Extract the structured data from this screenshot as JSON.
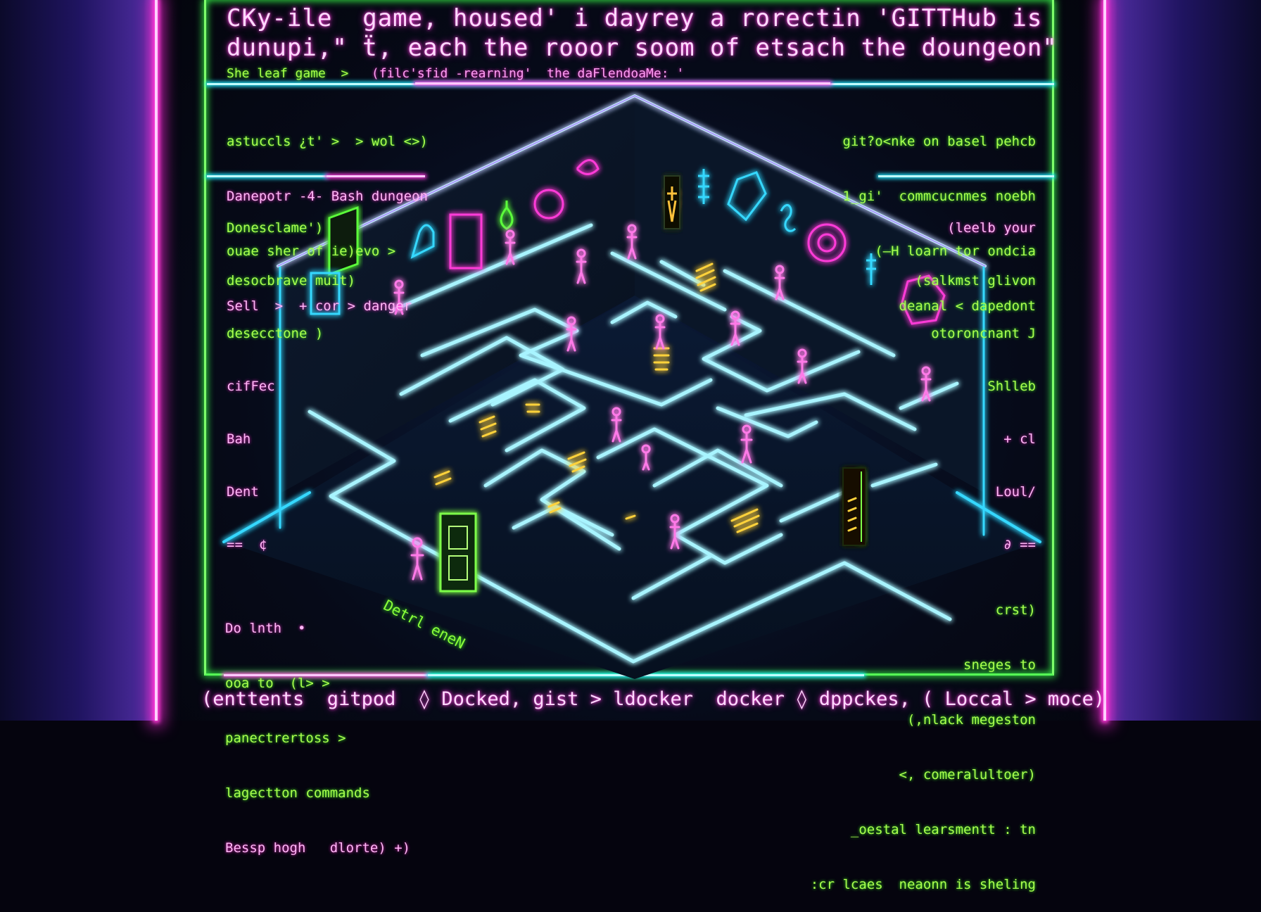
{
  "scene": {
    "title_lines": [
      "CKy-ile  game, housed' i dayrey a rorectin 'GITTHub is",
      "dunupi,\" ẗ, each the roоor soom of etsach the doungeon\""
    ],
    "subtitle": {
      "green": "She leaf game  >   ",
      "pink": "(filc'sfid -rearning'  the daFlendoaMe: '"
    },
    "floor_label": "Detrl eneN"
  },
  "left_panel_top": [
    {
      "text": "astuccls ¿t' >  > wol <>)",
      "color": "green"
    },
    {
      "text": "Danepotr -4- Bash dungeon",
      "color": "pink"
    },
    {
      "text": "ouae sher of ie)evo >",
      "color": "green"
    },
    {
      "text": "Sell  >  + cor > danger",
      "color": "pink"
    }
  ],
  "left_panel_mid": [
    {
      "text": "Donesclame')",
      "color": "green"
    },
    {
      "text": "desocbrave muit)",
      "color": "green"
    },
    {
      "text": "desecctone )",
      "color": "green"
    },
    {
      "text": "cifFec",
      "color": "pink"
    },
    {
      "text": "Bah",
      "color": "pink"
    },
    {
      "text": "Dent",
      "color": "pink"
    },
    {
      "text": "==  ¢",
      "color": "pink"
    }
  ],
  "right_panel_top": [
    {
      "text": "git?o<nke on basel pehcb",
      "color": "green"
    },
    {
      "text": "1_gi'  commcucnmes noebh",
      "color": "green"
    },
    {
      "text": "(—H loarn tor ondcia",
      "color": "green"
    },
    {
      "text": "deanal < dapedont",
      "color": "green"
    }
  ],
  "right_panel_mid": [
    {
      "text": "(leelb your",
      "color": "pink"
    },
    {
      "text": "(salkmst glivon",
      "color": "green"
    },
    {
      "text": "otoroncnant J",
      "color": "green"
    },
    {
      "text": "Shlleb",
      "color": "green"
    },
    {
      "text": "+ cl",
      "color": "pink"
    },
    {
      "text": "Loul/",
      "color": "pink"
    },
    {
      "text": "∂ ==",
      "color": "pink"
    }
  ],
  "left_panel_bottom": [
    {
      "text": "Do lnth  •",
      "color": "pink"
    },
    {
      "text": "ooa to  (l> >",
      "color": "green"
    },
    {
      "text": "panectrertoss >",
      "color": "green"
    },
    {
      "text": "lagectton commands",
      "color": "green"
    },
    {
      "text": "Bessp hogh   dlorte) +)",
      "color": "pink"
    }
  ],
  "right_panel_bottom": [
    {
      "text": "crst)",
      "color": "green"
    },
    {
      "text": "sneges to",
      "color": "green"
    },
    {
      "text": "(,nlack megeston",
      "color": "green"
    },
    {
      "text": "<, comeralultoer)",
      "color": "green"
    },
    {
      "text": "_oestal learsmentt : tn",
      "color": "green"
    },
    {
      "text": ":cr lcaes  neaonn is sheling",
      "color": "green"
    }
  ],
  "bottom_bar": "(enttents  gitpod  ◊ Docked, gist > ldocker  docker ◊ dppckes, ( Loccal > moce)",
  "colors": {
    "neon_pink": "#ff3ad8",
    "neon_green": "#7dff6a",
    "neon_cyan": "#21e6ff",
    "neon_yellow": "#ffd23a",
    "background": "#05040e"
  }
}
